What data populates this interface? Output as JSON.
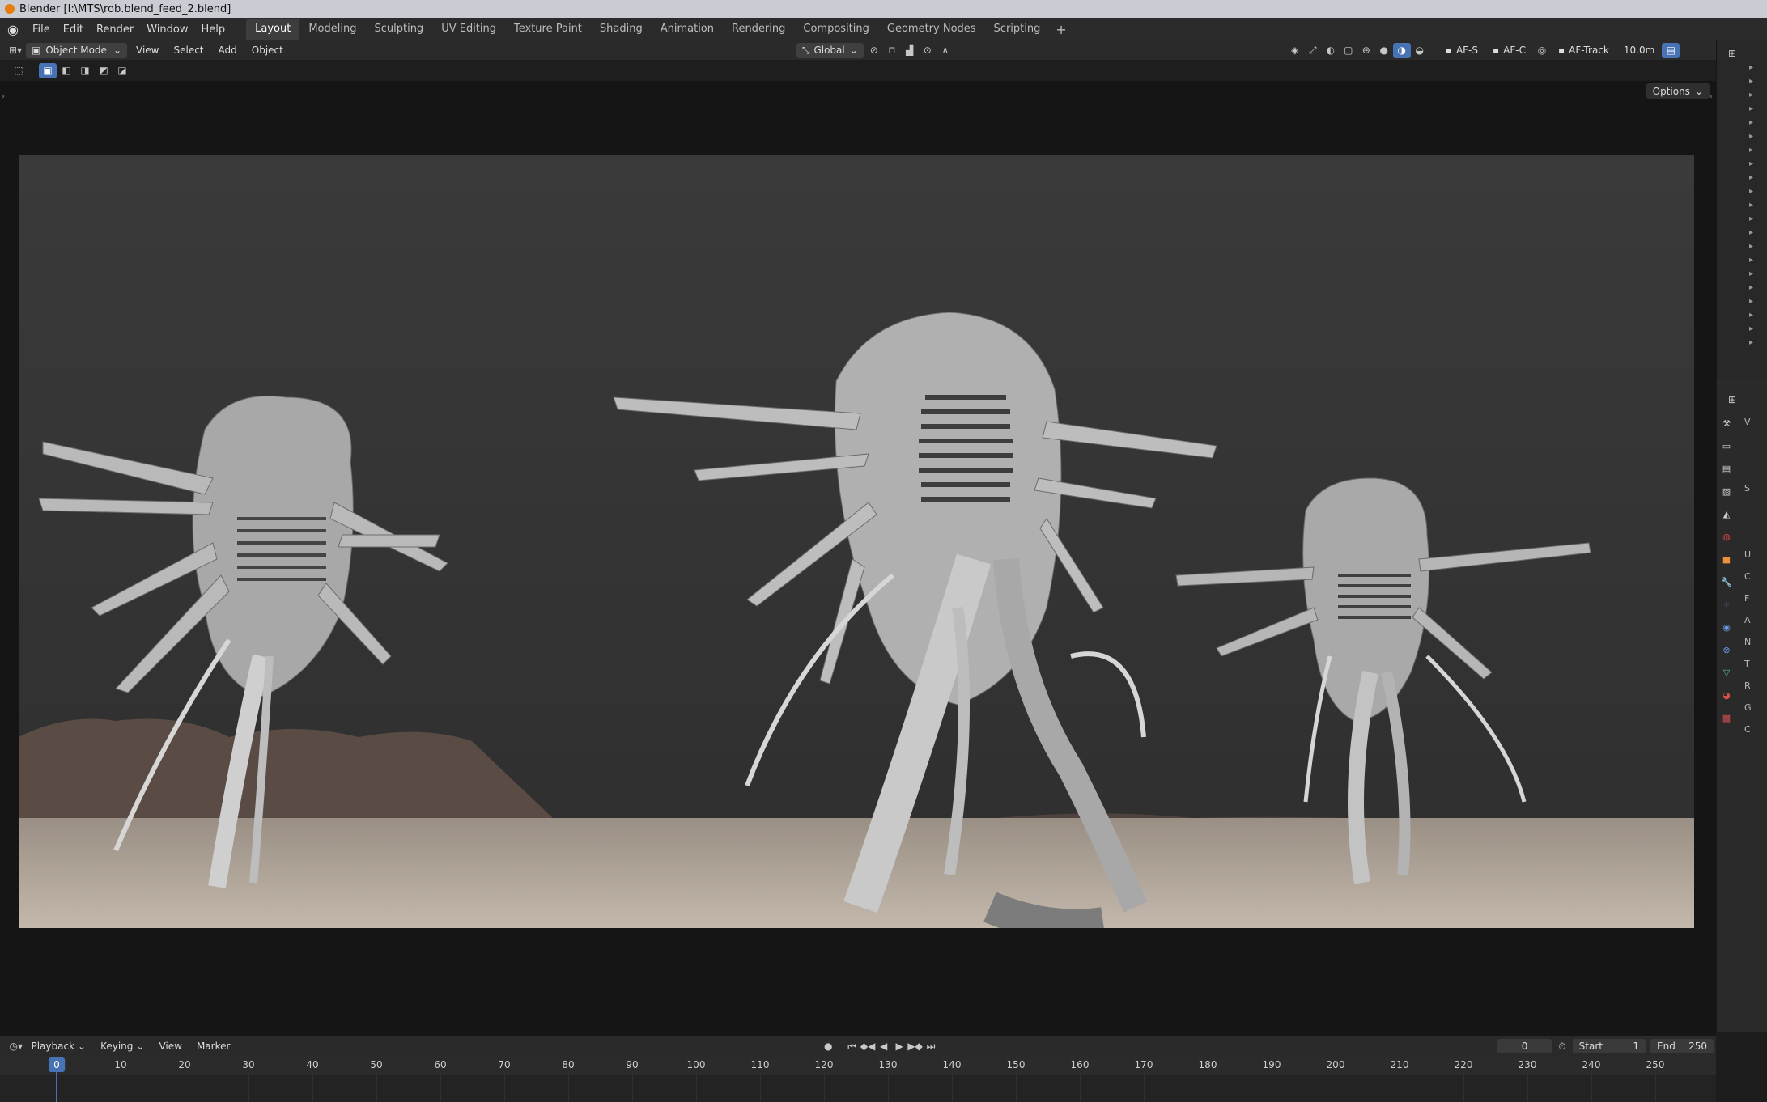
{
  "window": {
    "title": "Blender [I:\\MTS\\rob.blend_feed_2.blend]"
  },
  "menu": [
    "File",
    "Edit",
    "Render",
    "Window",
    "Help"
  ],
  "workspaces": {
    "active": "Layout",
    "tabs": [
      "Layout",
      "Modeling",
      "Sculpting",
      "UV Editing",
      "Texture Paint",
      "Shading",
      "Animation",
      "Rendering",
      "Compositing",
      "Geometry Nodes",
      "Scripting"
    ],
    "add": "+"
  },
  "viewport_header": {
    "mode": "Object Mode",
    "menus": [
      "View",
      "Select",
      "Add",
      "Object"
    ],
    "orientation": "Global",
    "af_s": "AF-S",
    "af_c": "AF-C",
    "af_track": "AF-Track",
    "distance": "10.0m"
  },
  "viewport": {
    "options": "Options"
  },
  "timeline": {
    "menus": [
      "Playback",
      "Keying",
      "View",
      "Marker"
    ],
    "current_frame": "0",
    "start_label": "Start",
    "start": "1",
    "end_label": "End",
    "end": "250",
    "ticks": [
      "10",
      "20",
      "30",
      "40",
      "50",
      "60",
      "70",
      "80",
      "90",
      "100",
      "110",
      "120",
      "130",
      "140",
      "150",
      "160",
      "170",
      "180",
      "190",
      "200",
      "210",
      "220",
      "230",
      "240",
      "250"
    ],
    "playhead": "0"
  },
  "properties": {
    "panels": [
      "V",
      "S",
      "U",
      "C",
      "F",
      "A",
      "N",
      "T",
      "R",
      "G",
      "C"
    ]
  },
  "colors": {
    "accent": "#4772b3",
    "bg": "#1d1d1d",
    "header": "#2a2a2a"
  }
}
